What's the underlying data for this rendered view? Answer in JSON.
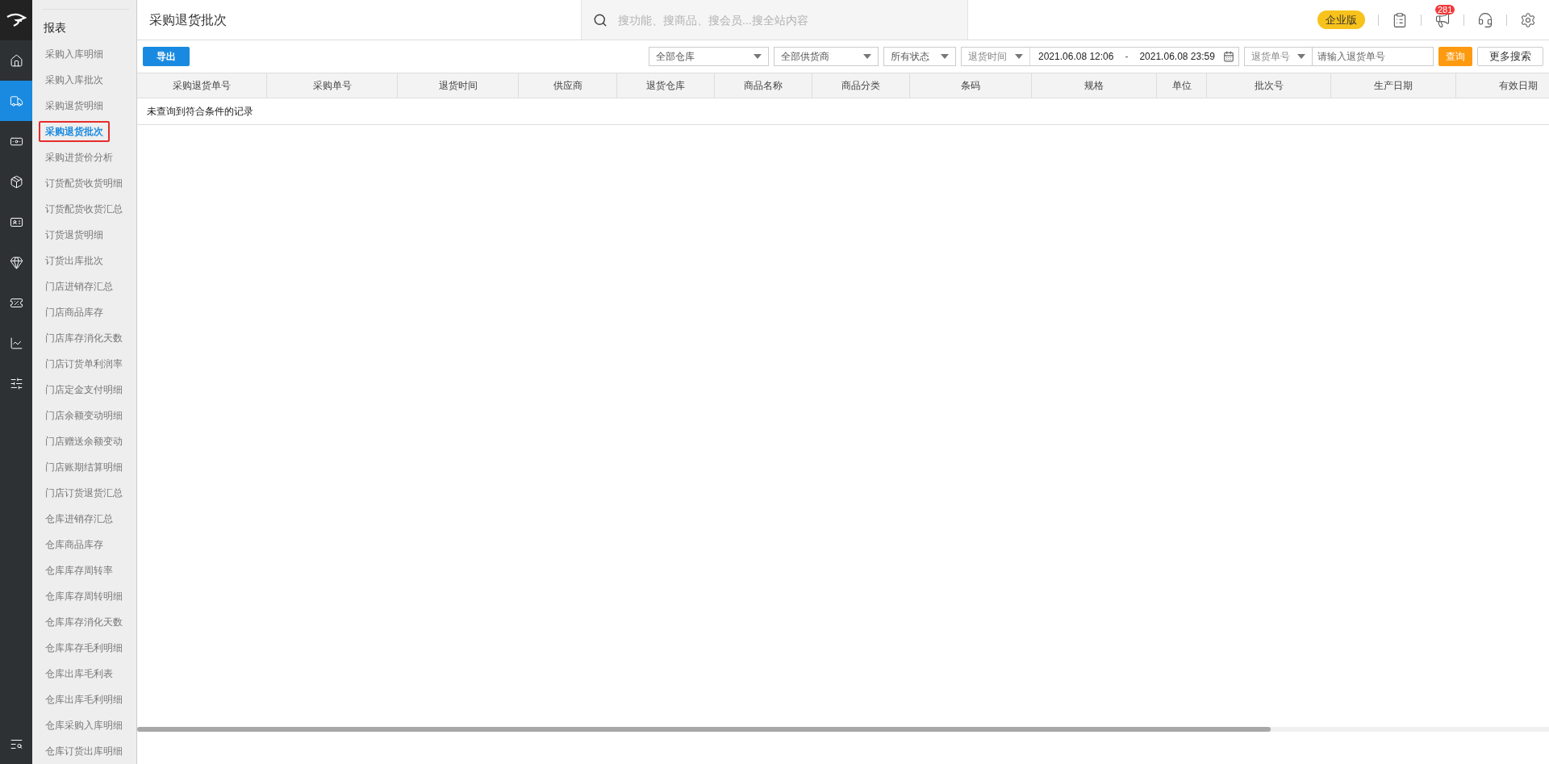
{
  "rail": {
    "items": [
      {
        "selected": false
      },
      {
        "selected": true
      },
      {
        "selected": false
      },
      {
        "selected": false
      },
      {
        "selected": false
      },
      {
        "selected": false
      },
      {
        "selected": false
      },
      {
        "selected": false
      },
      {
        "selected": false
      }
    ]
  },
  "sidebar": {
    "section": "报表",
    "items": [
      {
        "label": "采购入库明细",
        "selected": false
      },
      {
        "label": "采购入库批次",
        "selected": false
      },
      {
        "label": "采购退货明细",
        "selected": false
      },
      {
        "label": "采购退货批次",
        "selected": true
      },
      {
        "label": "采购进货价分析",
        "selected": false
      },
      {
        "label": "订货配货收货明细",
        "selected": false
      },
      {
        "label": "订货配货收货汇总",
        "selected": false
      },
      {
        "label": "订货退货明细",
        "selected": false
      },
      {
        "label": "订货出库批次",
        "selected": false
      },
      {
        "label": "门店进销存汇总",
        "selected": false
      },
      {
        "label": "门店商品库存",
        "selected": false
      },
      {
        "label": "门店库存消化天数",
        "selected": false
      },
      {
        "label": "门店订货单利润率",
        "selected": false
      },
      {
        "label": "门店定金支付明细",
        "selected": false
      },
      {
        "label": "门店余额变动明细",
        "selected": false
      },
      {
        "label": "门店赠送余额变动",
        "selected": false
      },
      {
        "label": "门店账期结算明细",
        "selected": false
      },
      {
        "label": "门店订货退货汇总",
        "selected": false
      },
      {
        "label": "仓库进销存汇总",
        "selected": false
      },
      {
        "label": "仓库商品库存",
        "selected": false
      },
      {
        "label": "仓库库存周转率",
        "selected": false
      },
      {
        "label": "仓库库存周转明细",
        "selected": false
      },
      {
        "label": "仓库库存消化天数",
        "selected": false
      },
      {
        "label": "仓库库存毛利明细",
        "selected": false
      },
      {
        "label": "仓库出库毛利表",
        "selected": false
      },
      {
        "label": "仓库出库毛利明细",
        "selected": false
      },
      {
        "label": "仓库采购入库明细",
        "selected": false
      },
      {
        "label": "仓库订货出库明细",
        "selected": false
      }
    ]
  },
  "header": {
    "title": "采购退货批次",
    "search_placeholder": "搜功能、搜商品、搜会员...搜全站内容",
    "edition": "企业版",
    "notification_count": "281"
  },
  "toolbar": {
    "export": "导出",
    "selects": [
      "全部仓库",
      "全部供货商",
      "所有状态"
    ],
    "date_type": "退货时间",
    "date_from": "2021.06.08 12:06",
    "date_sep": "-",
    "date_to": "2021.06.08 23:59",
    "number_type": "退货单号",
    "number_placeholder": "请输入退货单号",
    "query": "查询",
    "more": "更多搜索"
  },
  "table": {
    "columns": [
      "采购退货单号",
      "采购单号",
      "退货时间",
      "供应商",
      "退货仓库",
      "商品名称",
      "商品分类",
      "条码",
      "规格",
      "单位",
      "批次号",
      "生产日期",
      "有效日期"
    ],
    "empty": "未查询到符合条件的记录"
  }
}
